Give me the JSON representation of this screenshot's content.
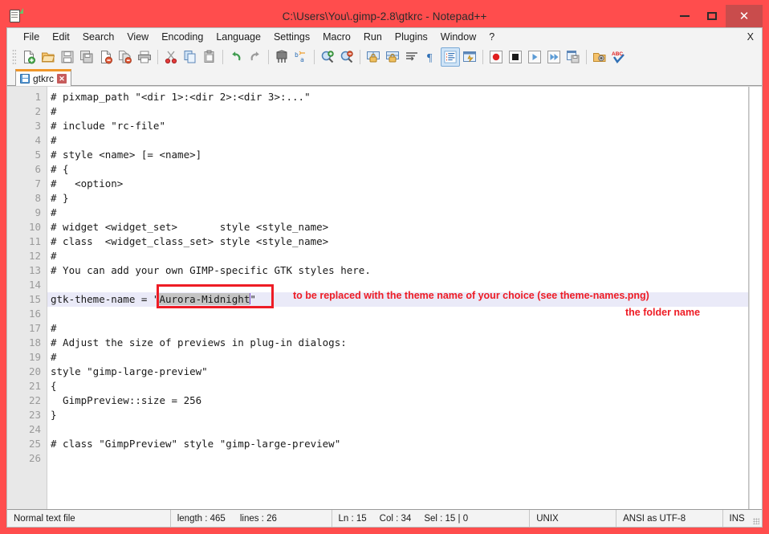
{
  "window": {
    "title": "C:\\Users\\You\\.gimp-2.8\\gtkrc - Notepad++",
    "titlebar_color": "#ff4d4d",
    "close_button_color": "#c94c4c",
    "controls": {
      "minimize": "–",
      "maximize": "□",
      "close": "✕"
    }
  },
  "menubar": {
    "items": [
      {
        "label": "File"
      },
      {
        "label": "Edit"
      },
      {
        "label": "Search"
      },
      {
        "label": "View"
      },
      {
        "label": "Encoding"
      },
      {
        "label": "Language"
      },
      {
        "label": "Settings"
      },
      {
        "label": "Macro"
      },
      {
        "label": "Run"
      },
      {
        "label": "Plugins"
      },
      {
        "label": "Window"
      },
      {
        "label": "?"
      }
    ],
    "close_document": "X"
  },
  "toolbar": {
    "buttons": [
      {
        "name": "new-file-icon"
      },
      {
        "name": "open-file-icon"
      },
      {
        "name": "save-icon"
      },
      {
        "name": "save-all-icon"
      },
      {
        "name": "close-file-icon"
      },
      {
        "name": "close-all-files-icon"
      },
      {
        "name": "print-icon"
      },
      {
        "name": "cut-icon"
      },
      {
        "name": "copy-icon"
      },
      {
        "name": "paste-icon"
      },
      {
        "name": "undo-icon"
      },
      {
        "name": "redo-icon"
      },
      {
        "name": "find-icon"
      },
      {
        "name": "replace-icon"
      },
      {
        "name": "zoom-in-icon"
      },
      {
        "name": "zoom-out-icon"
      },
      {
        "name": "sync-vertical-scroll-icon"
      },
      {
        "name": "sync-horizontal-scroll-icon"
      },
      {
        "name": "word-wrap-icon"
      },
      {
        "name": "show-all-characters-icon"
      },
      {
        "name": "indent-guide-icon"
      },
      {
        "name": "user-defined-dialog-icon"
      },
      {
        "name": "record-macro-icon"
      },
      {
        "name": "stop-recording-icon"
      },
      {
        "name": "play-macro-icon"
      },
      {
        "name": "run-macro-multiple-icon"
      },
      {
        "name": "save-macro-icon"
      },
      {
        "name": "run-icon"
      },
      {
        "name": "spell-check-icon"
      }
    ]
  },
  "tabs": [
    {
      "label": "gtkrc",
      "close": "✕",
      "active": true
    }
  ],
  "editor": {
    "lines": [
      {
        "n": "1",
        "text": "# pixmap_path \"<dir 1>:<dir 2>:<dir 3>:...\""
      },
      {
        "n": "2",
        "text": "#"
      },
      {
        "n": "3",
        "text": "# include \"rc-file\""
      },
      {
        "n": "4",
        "text": "#"
      },
      {
        "n": "5",
        "text": "# style <name> [= <name>]"
      },
      {
        "n": "6",
        "text": "# {"
      },
      {
        "n": "7",
        "text": "#   <option>"
      },
      {
        "n": "8",
        "text": "# }"
      },
      {
        "n": "9",
        "text": "#"
      },
      {
        "n": "10",
        "text": "# widget <widget_set>       style <style_name>"
      },
      {
        "n": "11",
        "text": "# class  <widget_class_set> style <style_name>"
      },
      {
        "n": "12",
        "text": "#"
      },
      {
        "n": "13",
        "text": "# You can add your own GIMP-specific GTK styles here."
      },
      {
        "n": "14",
        "text": ""
      },
      {
        "n": "15",
        "text": "",
        "current": true,
        "prefix": "gtk-theme-name = \"",
        "selected": "Aurora-Midnight",
        "suffix": "\""
      },
      {
        "n": "16",
        "text": ""
      },
      {
        "n": "17",
        "text": "#"
      },
      {
        "n": "18",
        "text": "# Adjust the size of previews in plug-in dialogs:"
      },
      {
        "n": "19",
        "text": "#"
      },
      {
        "n": "20",
        "text": "style \"gimp-large-preview\""
      },
      {
        "n": "21",
        "text": "{"
      },
      {
        "n": "22",
        "text": "  GimpPreview::size = 256"
      },
      {
        "n": "23",
        "text": "}"
      },
      {
        "n": "24",
        "text": ""
      },
      {
        "n": "25",
        "text": "# class \"GimpPreview\" style \"gimp-large-preview\""
      },
      {
        "n": "26",
        "text": ""
      }
    ]
  },
  "annotations": {
    "highlight_color": "#ee1c25",
    "line1": "to be replaced with the theme name of your choice (see theme-names.png)",
    "line2": "the folder name"
  },
  "statusbar": {
    "file_type": "Normal text file",
    "length_label": "length : 465",
    "lines_label": "lines : 26",
    "ln": "Ln : 15",
    "col": "Col : 34",
    "sel": "Sel : 15 | 0",
    "eol": "UNIX",
    "encoding": "ANSI as UTF-8",
    "insert_mode": "INS"
  }
}
